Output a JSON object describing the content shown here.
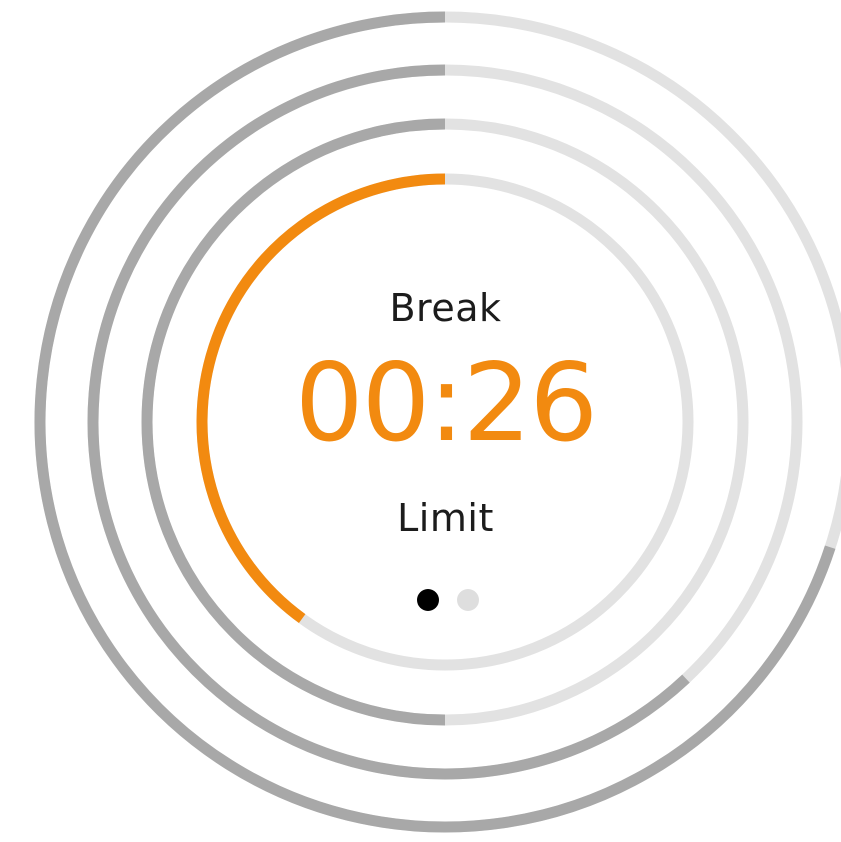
{
  "timer": {
    "title": "Break",
    "time": "00:26",
    "subtitle": "Limit"
  },
  "rings": [
    {
      "ring": "outer",
      "progress": 0.7,
      "fill_color": "#a8a8a8",
      "track_color": "#e2e2e2"
    },
    {
      "ring": "second",
      "progress": 0.62,
      "fill_color": "#a8a8a8",
      "track_color": "#e2e2e2"
    },
    {
      "ring": "third",
      "progress": 0.5,
      "fill_color": "#a8a8a8",
      "track_color": "#e2e2e2"
    },
    {
      "ring": "active",
      "progress": 0.4,
      "fill_color": "#f28a10",
      "track_color": "#e2e2e2"
    }
  ],
  "pager": {
    "count": 2,
    "active_index": 0,
    "active_color": "#000000",
    "inactive_color": "#dedede"
  },
  "colors": {
    "accent": "#f28a10",
    "text": "#1c1c1c"
  }
}
